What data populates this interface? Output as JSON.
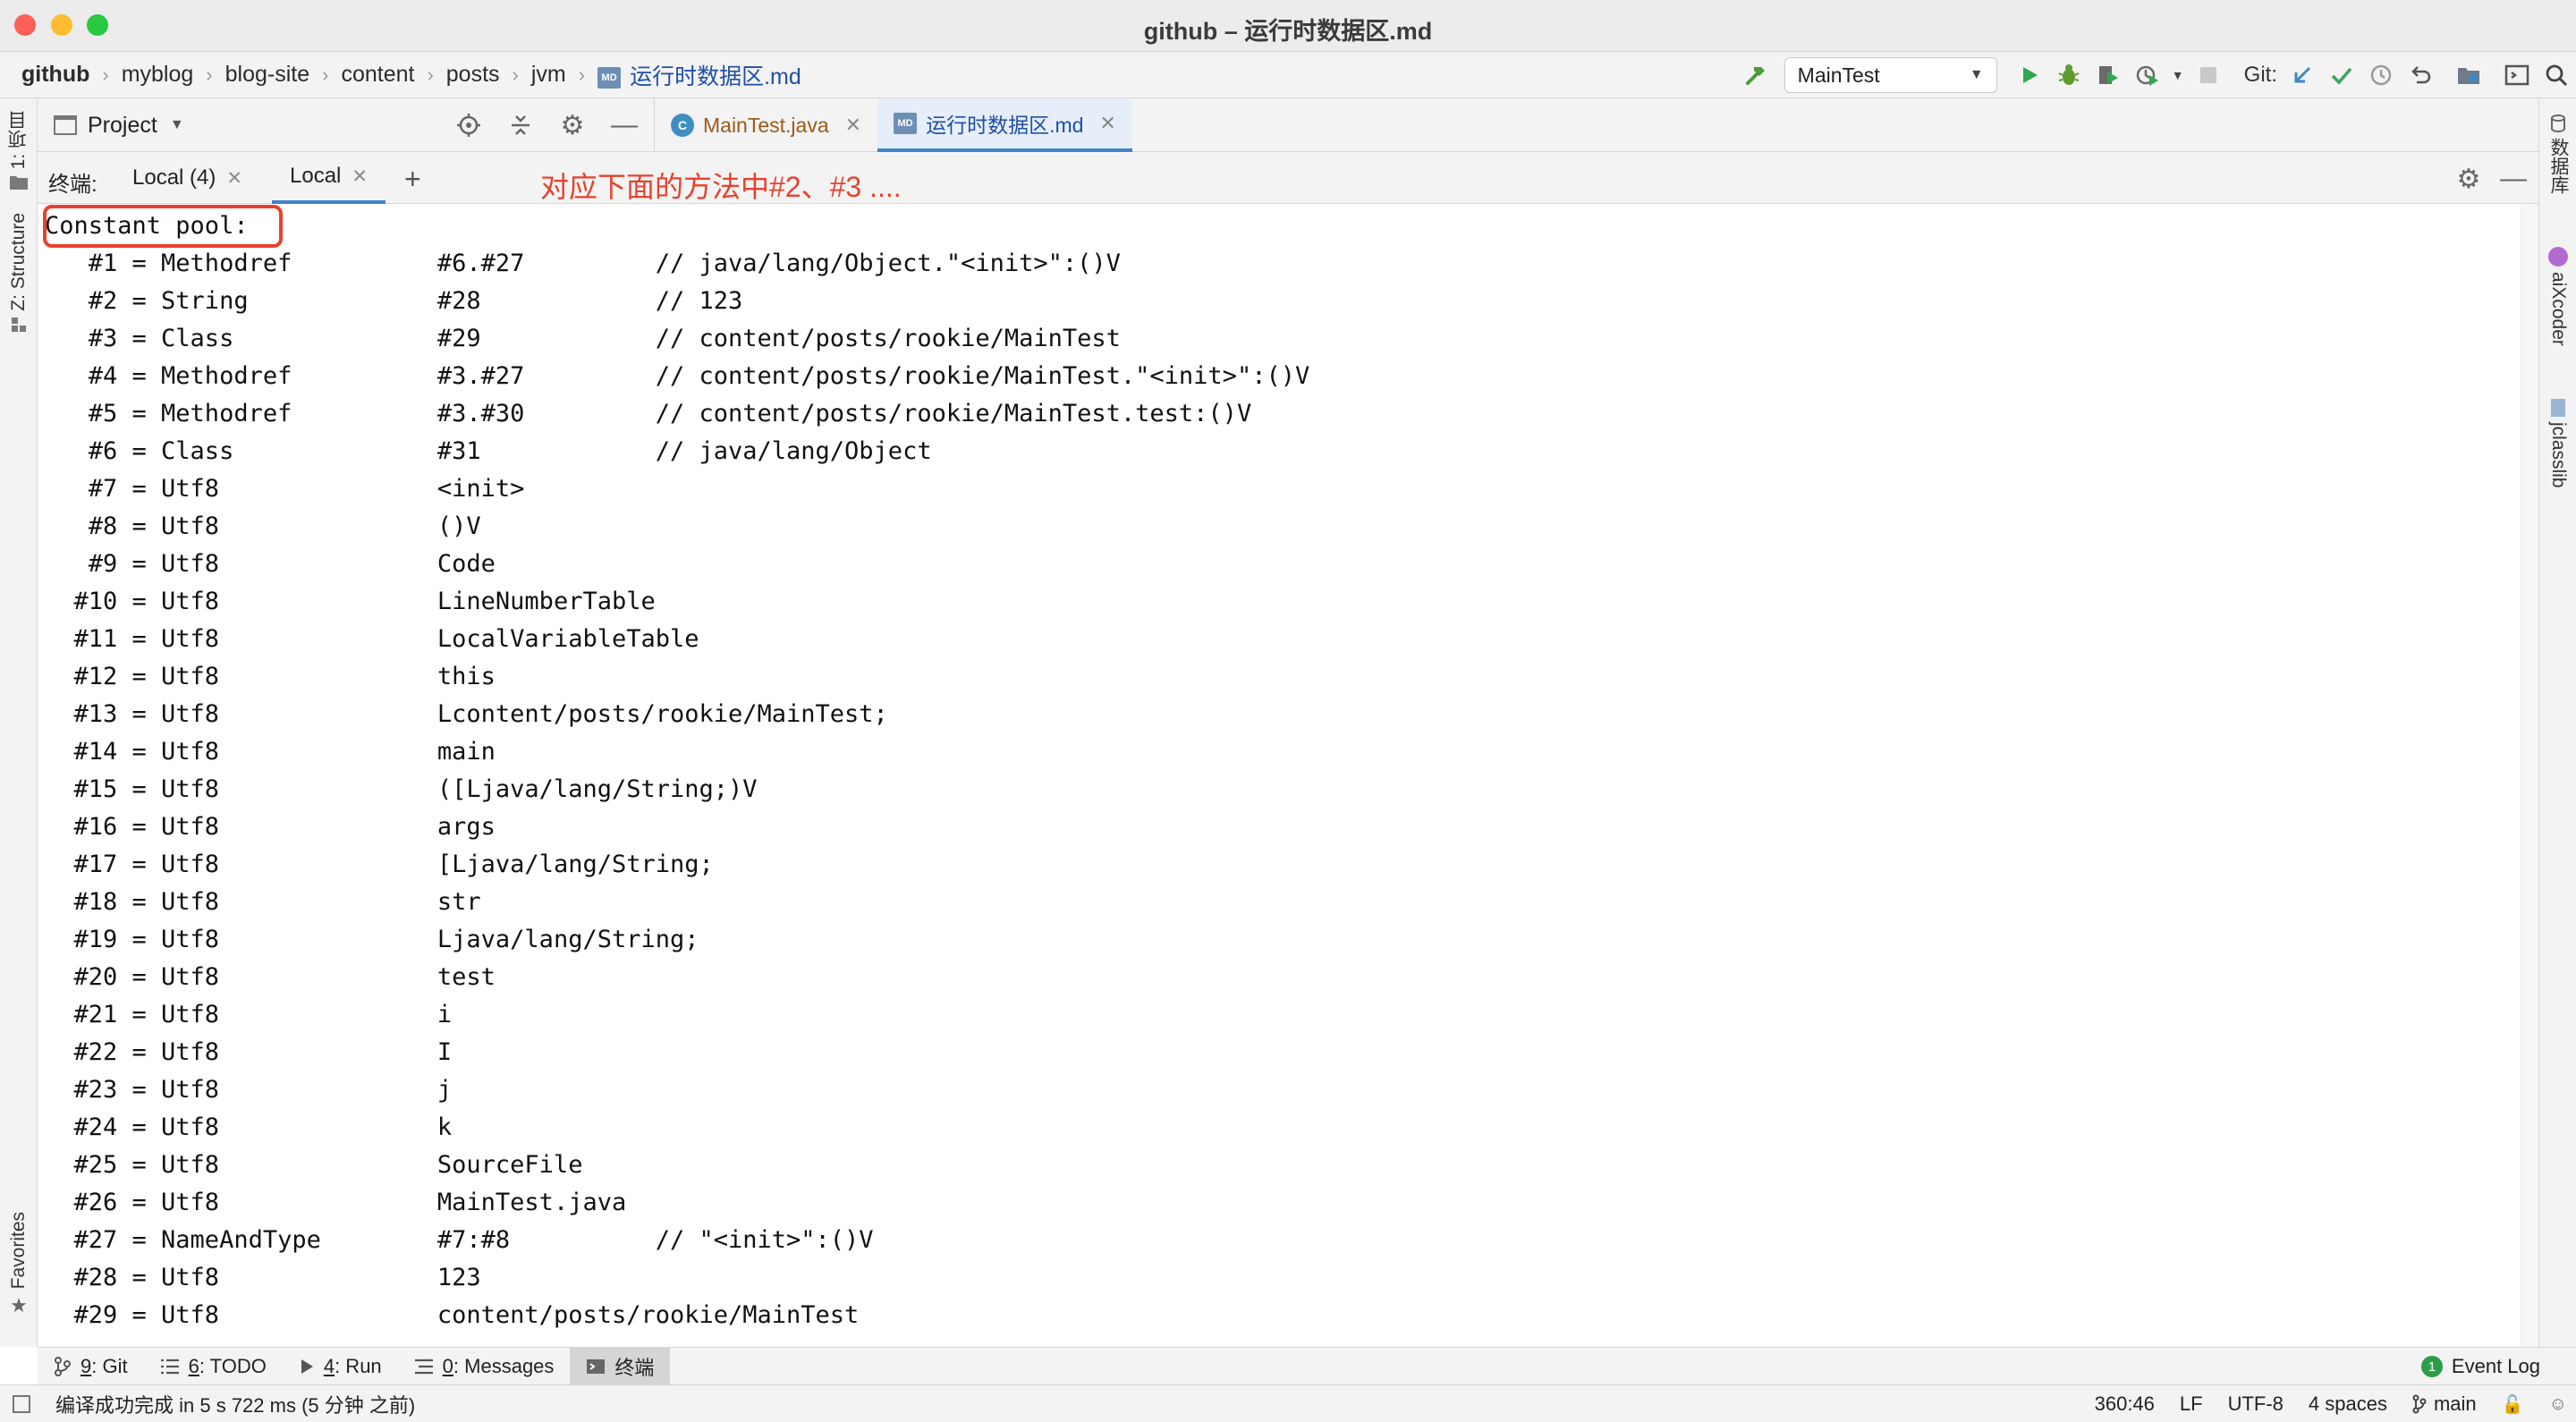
{
  "window": {
    "title": "github – 运行时数据区.md"
  },
  "breadcrumbs": [
    "github",
    "myblog",
    "blog-site",
    "content",
    "posts",
    "jvm"
  ],
  "breadcrumb_file": "运行时数据区.md",
  "breadcrumb_file_badge": "MD",
  "toolbar": {
    "run_config": "MainTest",
    "git_label": "Git:"
  },
  "left_stripe": {
    "project": "1: 项目",
    "structure": "Z: Structure",
    "favorites": "Favorites"
  },
  "right_stripe": {
    "database": "数据库",
    "aixcoder": "aiXcoder",
    "jclasslib": "jclasslib"
  },
  "project_pane": {
    "label": "Project"
  },
  "editor_tabs": [
    {
      "label": "MainTest.java",
      "icon": "C",
      "active": false
    },
    {
      "label": "运行时数据区.md",
      "icon": "MD",
      "active": true
    }
  ],
  "terminal": {
    "label": "终端:",
    "tabs": [
      {
        "label": "Local (4)",
        "active": false
      },
      {
        "label": "Local",
        "active": true
      }
    ],
    "annotation": "对应下面的方法中#2、#3 ....",
    "lines": [
      "Constant pool:",
      "   #1 = Methodref          #6.#27         // java/lang/Object.\"<init>\":()V",
      "   #2 = String             #28            // 123",
      "   #3 = Class              #29            // content/posts/rookie/MainTest",
      "   #4 = Methodref          #3.#27         // content/posts/rookie/MainTest.\"<init>\":()V",
      "   #5 = Methodref          #3.#30         // content/posts/rookie/MainTest.test:()V",
      "   #6 = Class              #31            // java/lang/Object",
      "   #7 = Utf8               <init>",
      "   #8 = Utf8               ()V",
      "   #9 = Utf8               Code",
      "  #10 = Utf8               LineNumberTable",
      "  #11 = Utf8               LocalVariableTable",
      "  #12 = Utf8               this",
      "  #13 = Utf8               Lcontent/posts/rookie/MainTest;",
      "  #14 = Utf8               main",
      "  #15 = Utf8               ([Ljava/lang/String;)V",
      "  #16 = Utf8               args",
      "  #17 = Utf8               [Ljava/lang/String;",
      "  #18 = Utf8               str",
      "  #19 = Utf8               Ljava/lang/String;",
      "  #20 = Utf8               test",
      "  #21 = Utf8               i",
      "  #22 = Utf8               I",
      "  #23 = Utf8               j",
      "  #24 = Utf8               k",
      "  #25 = Utf8               SourceFile",
      "  #26 = Utf8               MainTest.java",
      "  #27 = NameAndType        #7:#8          // \"<init>\":()V",
      "  #28 = Utf8               123",
      "  #29 = Utf8               content/posts/rookie/MainTest"
    ]
  },
  "bottom_tools": [
    {
      "key": "9",
      "label": ": Git",
      "icon": "git-icon"
    },
    {
      "key": "6",
      "label": ": TODO",
      "icon": "todo-icon"
    },
    {
      "key": "4",
      "label": ": Run",
      "icon": "run-icon"
    },
    {
      "key": "0",
      "label": ": Messages",
      "icon": "messages-icon"
    },
    {
      "key": "",
      "label": "终端",
      "icon": "terminal-icon",
      "active": true
    }
  ],
  "event_log": {
    "label": "Event Log",
    "count": "1"
  },
  "status": {
    "message": "编译成功完成 in 5 s 722 ms (5 分钟 之前)",
    "position": "360:46",
    "line_sep": "LF",
    "encoding": "UTF-8",
    "indent": "4 spaces",
    "branch": "main"
  },
  "colors": {
    "accent": "#4083c9",
    "annotation": "#e8412d",
    "run_green": "#2fa84f",
    "debug_green": "#5d9b2e"
  }
}
